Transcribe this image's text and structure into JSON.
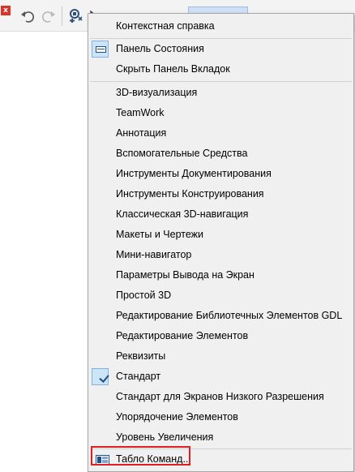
{
  "toolbar": {
    "close_glyph": "x",
    "icons": [
      "close-icon",
      "undo-icon",
      "redo-icon",
      "toolbars-icon",
      "cursor-icon"
    ]
  },
  "colors": {
    "highlight": "#e02020",
    "menu_background": "#f0f0f0",
    "check_state_background": "#cce4f7"
  },
  "menu": {
    "context_help": "Контекстная справка",
    "status_bar": "Панель Состояния",
    "hide_tab_bar": "Скрыть Панель Вкладок",
    "toolbars": [
      "3D-визуализация",
      "TeamWork",
      "Аннотация",
      "Вспомогательные Средства",
      "Инструменты Документирования",
      "Инструменты Конструирования",
      "Классическая 3D-навигация",
      "Макеты и Чертежи",
      "Мини-навигатор",
      "Параметры Вывода на Экран",
      "Простой 3D",
      "Редактирование Библиотечных Элементов GDL",
      "Редактирование Элементов",
      "Реквизиты",
      "Стандарт",
      "Стандарт для Экранов Низкого Разрешения",
      "Упорядочение Элементов",
      "Уровень Увеличения"
    ],
    "checked_toolbar": "Стандарт",
    "command_layout": "Табло Команд..."
  }
}
